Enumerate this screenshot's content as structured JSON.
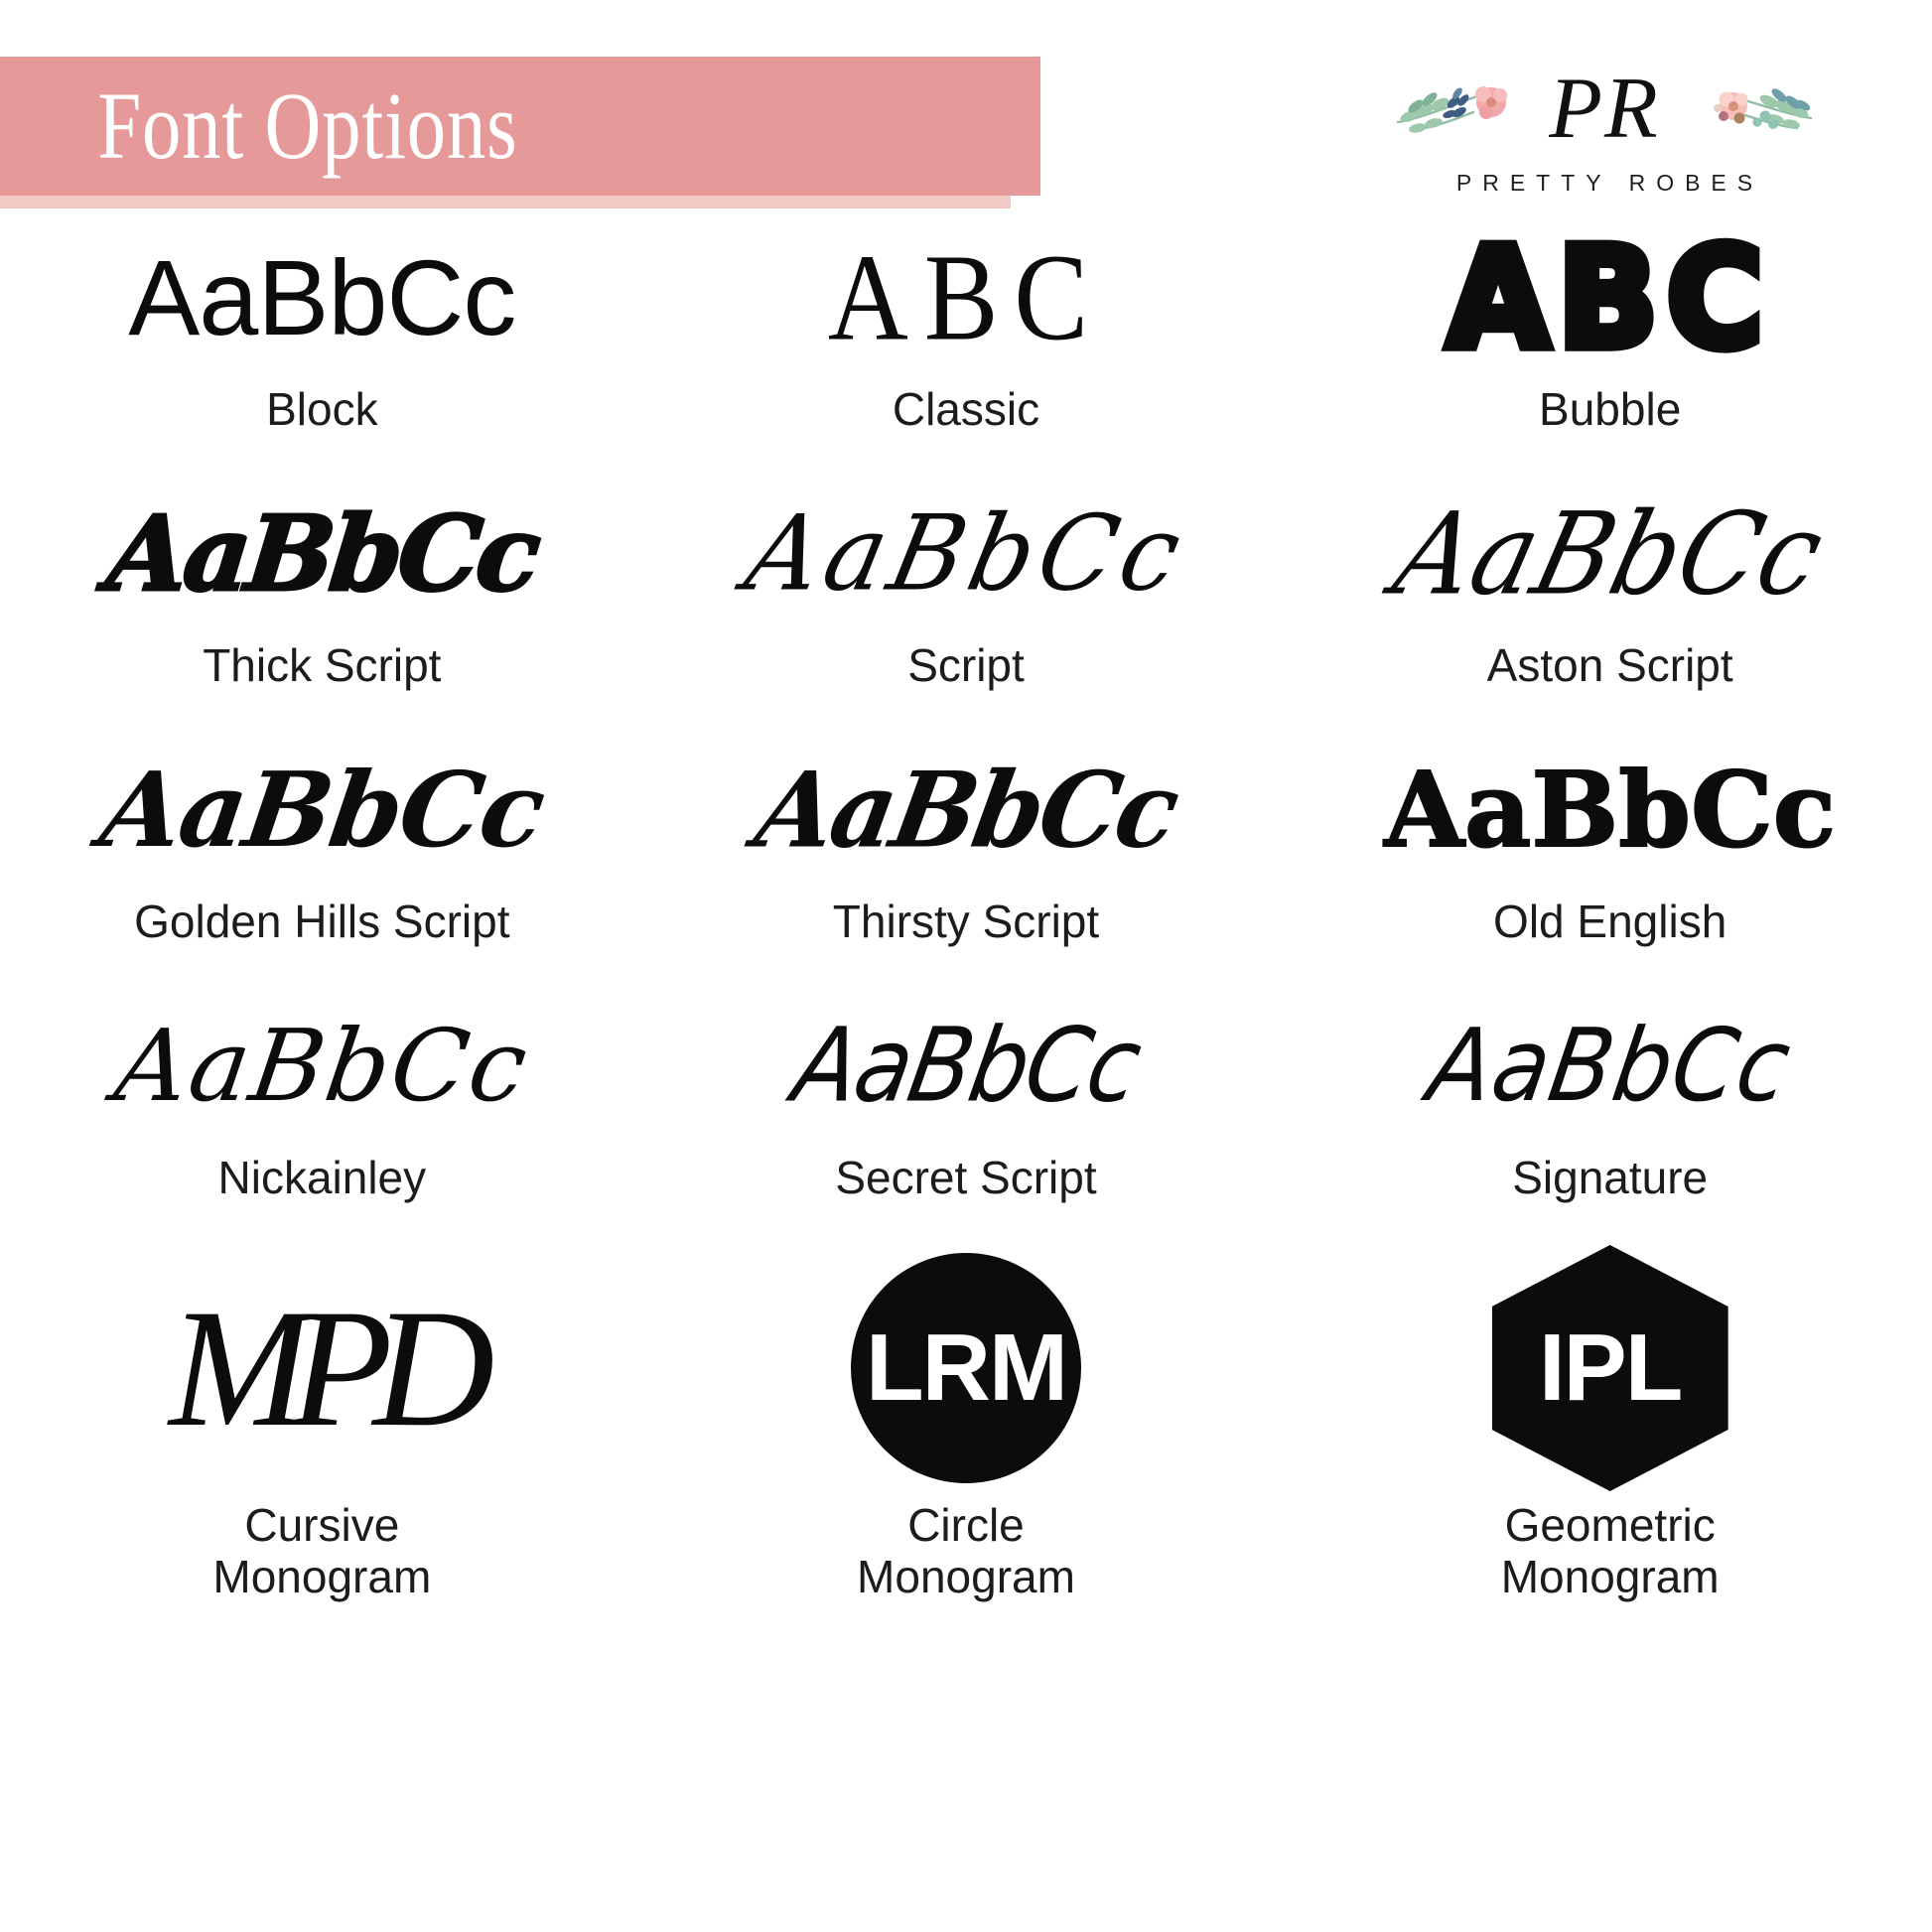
{
  "header": {
    "banner_title": "Font Options",
    "banner_color": "#e59a99",
    "banner_shadow_color": "#f3c9c6",
    "banner_text_color": "#ffffff"
  },
  "logo": {
    "monogram": "PR",
    "wordmark": "PRETTY ROBES",
    "sprig_left_icon": "floral-sprig-icon",
    "sprig_right_icon": "floral-sprig-icon",
    "leaf_green": "#8fbfa3",
    "leaf_teal": "#6f9fa8",
    "leaf_navy": "#3f5d82",
    "flower_pink": "#f2a9ab",
    "flower_center": "#c98b6a"
  },
  "fonts": [
    {
      "sample": "AaBbCc",
      "label": "Block",
      "label_line2": "",
      "style": "s-block"
    },
    {
      "sample": "ABC",
      "label": "Classic",
      "label_line2": "",
      "style": "s-classic"
    },
    {
      "sample": "ABC",
      "label": "Bubble",
      "label_line2": "",
      "style": "s-bubble"
    },
    {
      "sample": "AaBbCc",
      "label": "Thick Script",
      "label_line2": "",
      "style": "s-thick"
    },
    {
      "sample": "AaBbCc",
      "label": "Script",
      "label_line2": "",
      "style": "s-script"
    },
    {
      "sample": "AaBbCc",
      "label": "Aston Script",
      "label_line2": "",
      "style": "s-aston"
    },
    {
      "sample": "AaBbCc",
      "label": "Golden Hills Script",
      "label_line2": "",
      "style": "s-golden"
    },
    {
      "sample": "AaBbCc",
      "label": "Thirsty Script",
      "label_line2": "",
      "style": "s-thirsty"
    },
    {
      "sample": "AaBbCc",
      "label": "Old English",
      "label_line2": "",
      "style": "s-oldenglish"
    },
    {
      "sample": "AaBbCc",
      "label": "Nickainley",
      "label_line2": "",
      "style": "s-nickainley"
    },
    {
      "sample": "AaBbCc",
      "label": "Secret Script",
      "label_line2": "",
      "style": "s-secret"
    },
    {
      "sample": "AaBbCc",
      "label": "Signature",
      "label_line2": "",
      "style": "s-signature"
    }
  ],
  "monograms": [
    {
      "sample": "MPD",
      "label": "Cursive",
      "label_line2": "Monogram",
      "shape": "none"
    },
    {
      "sample": "LRM",
      "label": "Circle",
      "label_line2": "Monogram",
      "shape": "circle"
    },
    {
      "sample": "IPL",
      "label": "Geometric",
      "label_line2": "Monogram",
      "shape": "hexagon"
    }
  ]
}
